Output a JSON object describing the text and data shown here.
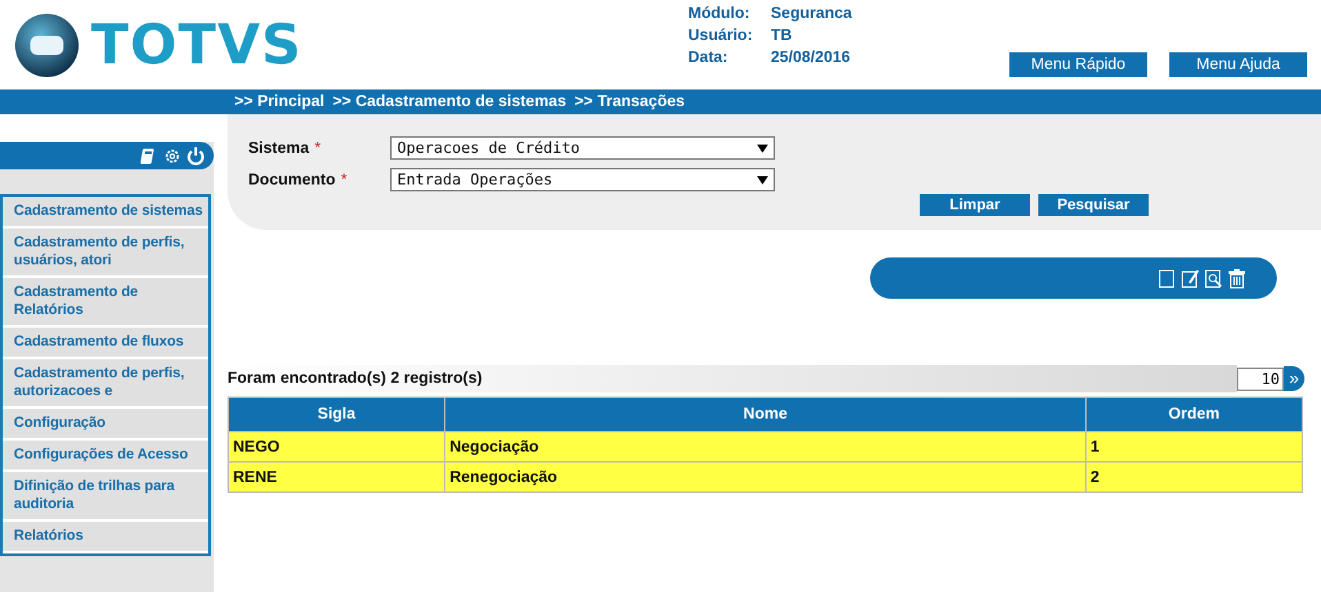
{
  "header": {
    "logo": "TOTVS",
    "info": [
      {
        "label": "Módulo:",
        "value": "Seguranca"
      },
      {
        "label": "Usuário:",
        "value": "TB"
      },
      {
        "label": "Data:",
        "value": "25/08/2016"
      }
    ],
    "buttons": [
      "Menu Rápido",
      "Menu Ajuda"
    ]
  },
  "breadcrumb": [
    ">> Principal",
    ">> Cadastramento de sistemas",
    ">> Transações"
  ],
  "sidebar": {
    "items": [
      {
        "label": "Cadastramento de sistemas"
      },
      {
        "label": "Cadastramento de perfis, usuários, atori"
      },
      {
        "label": "Cadastramento de Relatórios"
      },
      {
        "label": "Cadastramento de fluxos"
      },
      {
        "label": "Cadastramento de perfis, autorizacoes e"
      },
      {
        "label": "Configuração"
      },
      {
        "label": "Configurações de Acesso"
      },
      {
        "label": "Difinição de trilhas para auditoria"
      },
      {
        "label": "Relatórios"
      }
    ]
  },
  "form": {
    "fields": [
      {
        "label": "Sistema",
        "required_mark": "*",
        "value": "Operacoes de Crédito"
      },
      {
        "label": "Documento",
        "required_mark": "*",
        "value": "Entrada Operações"
      }
    ],
    "buttons": [
      "Limpar",
      "Pesquisar"
    ]
  },
  "results": {
    "summary": "Foram encontrado(s) 2 registro(s)",
    "page_size": "10",
    "next": "»",
    "table": {
      "columns": [
        "Sigla",
        "Nome",
        "Ordem"
      ],
      "rows": [
        [
          "NEGO",
          "Negociação",
          "1"
        ],
        [
          "RENE",
          "Renegociação",
          "2"
        ]
      ]
    }
  }
}
